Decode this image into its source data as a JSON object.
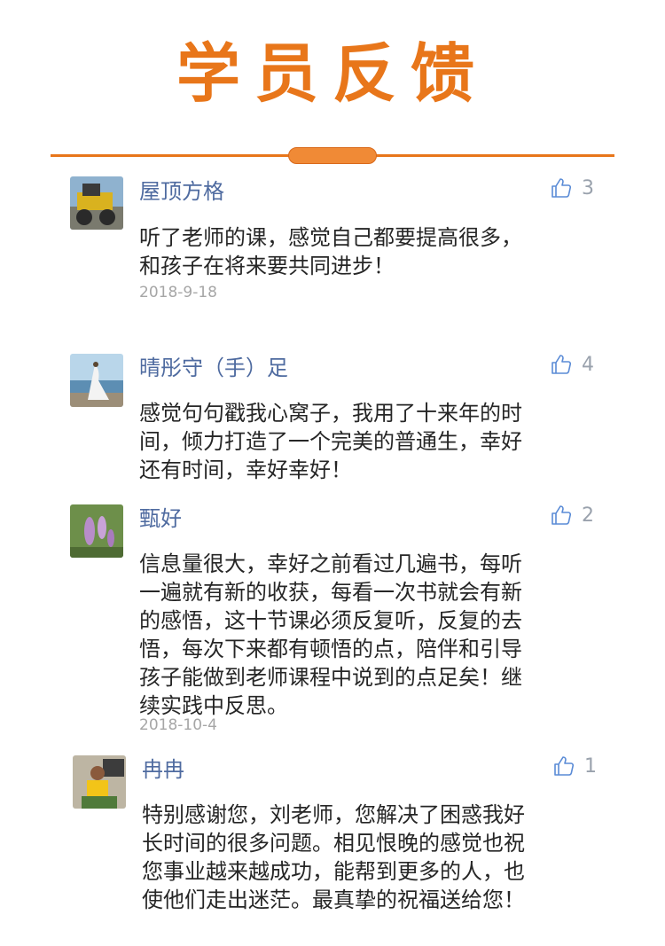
{
  "page": {
    "title": "学员反馈"
  },
  "comments": [
    {
      "name": "屋顶方格",
      "likes": "3",
      "lines": [
        "听了老师的课，感觉自己都要提高很多，",
        "和孩子在将来要共同进步！"
      ],
      "date": "2018-9-18"
    },
    {
      "name": "晴彤守（手）足",
      "likes": "4",
      "lines": [
        "感觉句句戳我心窝子，我用了十来年的时",
        "间，倾力打造了一个完美的普通生，幸好",
        "还有时间，幸好幸好！"
      ],
      "date": ""
    },
    {
      "name": "甄好",
      "likes": "2",
      "lines": [
        "信息量很大，幸好之前看过几遍书，每听",
        "一遍就有新的收获，每看一次书就会有新",
        "的感悟，这十节课必须反复听，反复的去",
        "悟，每次下来都有顿悟的点，陪伴和引导",
        "孩子能做到老师课程中说到的点足矣！继",
        "续实践中反思。"
      ],
      "date": "2018-10-4"
    },
    {
      "name": "冉冉",
      "likes": "1",
      "lines": [
        "特别感谢您，刘老师，您解决了困惑我好",
        "长时间的很多问题。相见恨晚的感觉也祝",
        "您事业越来越成功，能帮到更多的人，也",
        "使他们走出迷茫。最真挚的祝福送给您！"
      ],
      "date": ""
    }
  ],
  "icons": {
    "like": "thumbs-up-icon"
  },
  "colors": {
    "accent": "#e8761a",
    "name": "#4f6ba0",
    "muted": "#9aa2ad"
  }
}
